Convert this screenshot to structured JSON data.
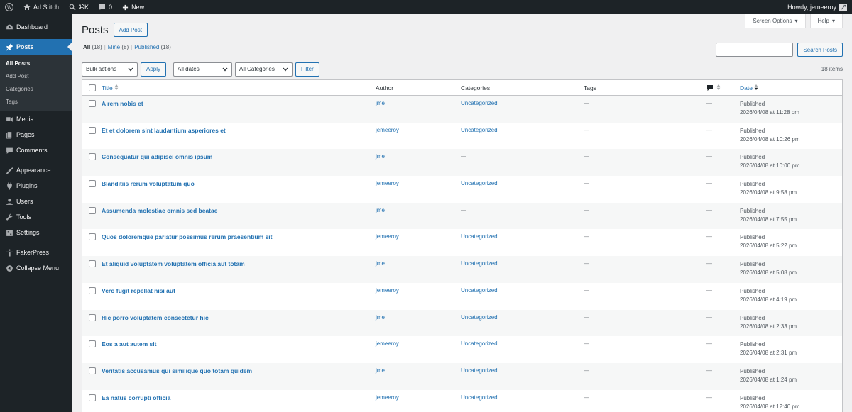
{
  "adminbar": {
    "site_name": "Ad Stitch",
    "shortcut": "⌘K",
    "comments_count": "0",
    "new_label": "New",
    "howdy": "Howdy, jemeeroy"
  },
  "sidebar": {
    "items": [
      {
        "label": "Dashboard",
        "icon": "dashboard-icon"
      },
      {
        "label": "Posts",
        "icon": "pin-icon"
      },
      {
        "label": "Media",
        "icon": "media-icon"
      },
      {
        "label": "Pages",
        "icon": "pages-icon"
      },
      {
        "label": "Comments",
        "icon": "comments-icon"
      },
      {
        "label": "Appearance",
        "icon": "brush-icon"
      },
      {
        "label": "Plugins",
        "icon": "plugin-icon"
      },
      {
        "label": "Users",
        "icon": "users-icon"
      },
      {
        "label": "Tools",
        "icon": "wrench-icon"
      },
      {
        "label": "Settings",
        "icon": "settings-icon"
      },
      {
        "label": "FakerPress",
        "icon": "fakerpress-icon"
      },
      {
        "label": "Collapse Menu",
        "icon": "collapse-icon"
      }
    ],
    "submenu": [
      "All Posts",
      "Add Post",
      "Categories",
      "Tags"
    ]
  },
  "screen_options": "Screen Options",
  "help": "Help",
  "page": {
    "title": "Posts",
    "add_button": "Add Post"
  },
  "views": {
    "all": "All",
    "all_count": "(18)",
    "mine": "Mine",
    "mine_count": "(8)",
    "published": "Published",
    "published_count": "(18)",
    "sep": "|"
  },
  "search": {
    "button": "Search Posts",
    "value": ""
  },
  "tablenav": {
    "bulk": "Bulk actions",
    "apply": "Apply",
    "dates": "All dates",
    "categories": "All Categories",
    "filter": "Filter",
    "items_count": "18 items"
  },
  "columns": {
    "title": "Title",
    "author": "Author",
    "categories": "Categories",
    "tags": "Tags",
    "date": "Date"
  },
  "rows": [
    {
      "title": "A rem nobis et",
      "author": "jme",
      "category": "Uncategorized",
      "tags": "—",
      "comments": "—",
      "status": "Published",
      "date": "2026/04/08 at 11:28 pm"
    },
    {
      "title": "Et et dolorem sint laudantium asperiores et",
      "author": "jemeeroy",
      "category": "Uncategorized",
      "tags": "—",
      "comments": "—",
      "status": "Published",
      "date": "2026/04/08 at 10:26 pm"
    },
    {
      "title": "Consequatur qui adipisci omnis ipsum",
      "author": "jme",
      "category": "—",
      "tags": "—",
      "comments": "—",
      "status": "Published",
      "date": "2026/04/08 at 10:00 pm"
    },
    {
      "title": "Blanditiis rerum voluptatum quo",
      "author": "jemeeroy",
      "category": "Uncategorized",
      "tags": "—",
      "comments": "—",
      "status": "Published",
      "date": "2026/04/08 at 9:58 pm"
    },
    {
      "title": "Assumenda molestiae omnis sed beatae",
      "author": "jme",
      "category": "—",
      "tags": "—",
      "comments": "—",
      "status": "Published",
      "date": "2026/04/08 at 7:55 pm"
    },
    {
      "title": "Quos doloremque pariatur possimus rerum praesentium sit",
      "author": "jemeeroy",
      "category": "Uncategorized",
      "tags": "—",
      "comments": "—",
      "status": "Published",
      "date": "2026/04/08 at 5:22 pm"
    },
    {
      "title": "Et aliquid voluptatem voluptatem officia aut totam",
      "author": "jme",
      "category": "Uncategorized",
      "tags": "—",
      "comments": "—",
      "status": "Published",
      "date": "2026/04/08 at 5:08 pm"
    },
    {
      "title": "Vero fugit repellat nisi aut",
      "author": "jemeeroy",
      "category": "Uncategorized",
      "tags": "—",
      "comments": "—",
      "status": "Published",
      "date": "2026/04/08 at 4:19 pm"
    },
    {
      "title": "Hic porro voluptatem consectetur hic",
      "author": "jme",
      "category": "Uncategorized",
      "tags": "—",
      "comments": "—",
      "status": "Published",
      "date": "2026/04/08 at 2:33 pm"
    },
    {
      "title": "Eos a aut autem sit",
      "author": "jemeeroy",
      "category": "Uncategorized",
      "tags": "—",
      "comments": "—",
      "status": "Published",
      "date": "2026/04/08 at 2:31 pm"
    },
    {
      "title": "Veritatis accusamus qui similique quo totam quidem",
      "author": "jme",
      "category": "Uncategorized",
      "tags": "—",
      "comments": "—",
      "status": "Published",
      "date": "2026/04/08 at 1:24 pm"
    },
    {
      "title": "Ea natus corrupti officia",
      "author": "jemeeroy",
      "category": "Uncategorized",
      "tags": "—",
      "comments": "—",
      "status": "Published",
      "date": "2026/04/08 at 12:40 pm"
    }
  ],
  "colors": {
    "adminbar_bg": "#1d2327",
    "accent": "#2271b1",
    "page_bg": "#f0f0f1"
  }
}
